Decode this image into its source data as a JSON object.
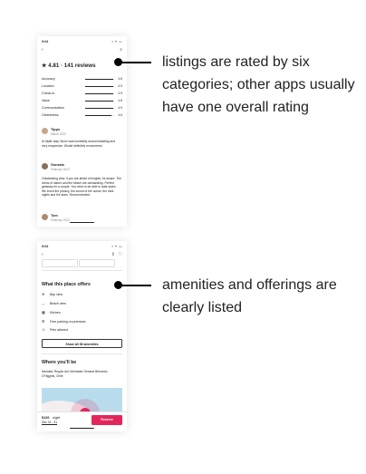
{
  "phone1": {
    "status_time": "9:04",
    "status_icons": "▪ ᯤ ▭",
    "back_icon": "‹",
    "search_icon": "⌕",
    "rating_title": "★ 4.81 · 141 reviews",
    "categories": [
      {
        "label": "Accuracy",
        "score": "4.8",
        "fraction": 0.96
      },
      {
        "label": "Location",
        "score": "4.9",
        "fraction": 0.98
      },
      {
        "label": "Check-in",
        "score": "4.9",
        "fraction": 0.98
      },
      {
        "label": "Value",
        "score": "4.8",
        "fraction": 0.96
      },
      {
        "label": "Communication",
        "score": "4.9",
        "fraction": 0.98
      },
      {
        "label": "Cleanliness",
        "score": "4.6",
        "fraction": 0.92
      }
    ],
    "reviews": [
      {
        "name": "Tipps",
        "date": "March 2022",
        "text": "Al idyllic stay. Mono was incredibly accommodating and very responsive. Would definitely recommend."
      },
      {
        "name": "Gonzalo",
        "date": "February 2022",
        "text": "Outstanding view. If you are afraid of heights, be aware. The views of nature and the beach are outstanding. Perfect getaway for a couple. You need to be able to walk stairs. We loved the privacy, the sound of the ocean, the dark nights and the stars. Recommended."
      },
      {
        "name": "Tom",
        "date": "February 2022"
      }
    ]
  },
  "phone2": {
    "status_time": "9:04",
    "status_icons": "▪ ᯤ ▭",
    "back_icon": "‹",
    "share_icon": "⇪",
    "heart_icon": "♡",
    "section_title": "What this place offers",
    "amenities": [
      {
        "icon": "≋",
        "label": "Bay view"
      },
      {
        "icon": "◡",
        "label": "Beach view"
      },
      {
        "icon": "▦",
        "label": "Kitchen"
      },
      {
        "icon": "⊟",
        "label": "Free parking on premises"
      },
      {
        "icon": "☺",
        "label": "Pets allowed"
      }
    ],
    "show_all_label": "Show all 38 amenities",
    "where_title": "Where you'll be",
    "location": "Navidad, Region del Libertador General Bernardo O'Higgins, Chile",
    "price": "$126",
    "price_unit": "night",
    "dates": "Dec 31 - 31",
    "reserve_label": "Reserve"
  },
  "annotations": {
    "top": [
      "listings are rated by six",
      "categories; other apps usually",
      "have one overall rating"
    ],
    "bottom": [
      "amenities and offerings are",
      "clearly listed"
    ]
  },
  "colors": {
    "accent": "#e4255d",
    "map_water": "#b9dcec"
  }
}
